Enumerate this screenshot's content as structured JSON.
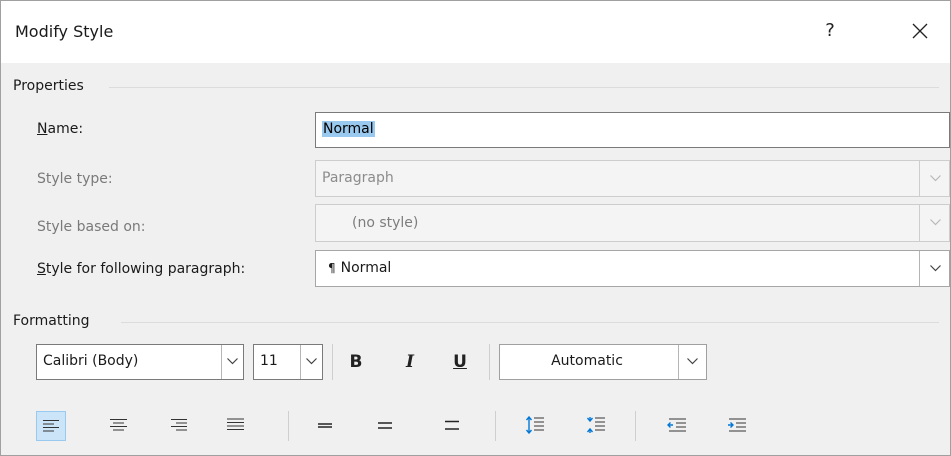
{
  "window": {
    "title": "Modify Style",
    "help_label": "?"
  },
  "properties": {
    "section_title": "Properties",
    "name": {
      "label_prefix": "",
      "label_mnemonic": "N",
      "label_rest": "ame:",
      "value": "Normal"
    },
    "style_type": {
      "label": "Style type:",
      "value": "Paragraph"
    },
    "style_based_on": {
      "label": "Style based on:",
      "value": "(no style)"
    },
    "following": {
      "label_mnemonic": "S",
      "label_rest": "tyle for following paragraph:",
      "value_icon": "¶",
      "value": "Normal"
    }
  },
  "formatting": {
    "section_title": "Formatting",
    "font_name": "Calibri (Body)",
    "font_size": "11",
    "bold_label": "B",
    "italic_label": "I",
    "underline_label": "U",
    "font_color": "Automatic",
    "alignment_selected": "align-left",
    "accent_color": "#0078d7"
  }
}
